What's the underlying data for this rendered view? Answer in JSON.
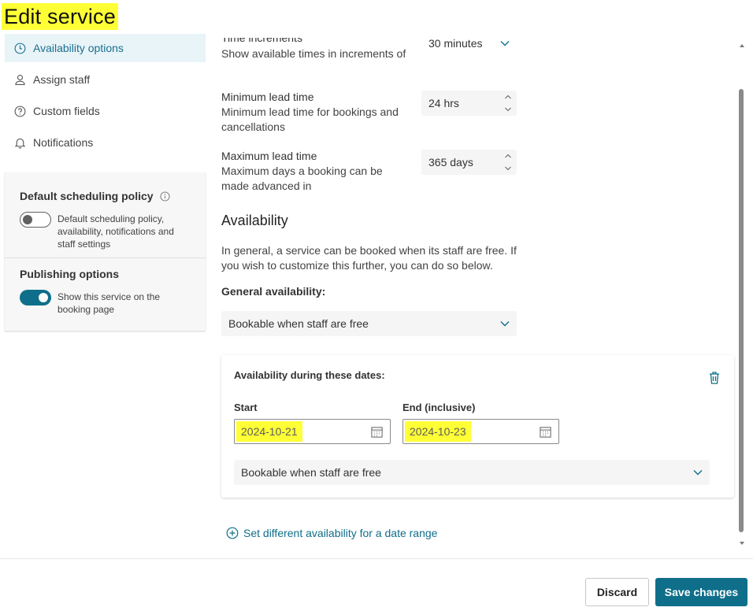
{
  "header": {
    "title": "Edit service"
  },
  "nav": {
    "items": [
      {
        "label": "Availability options",
        "icon": "clock-icon",
        "active": true
      },
      {
        "label": "Assign staff",
        "icon": "person-icon"
      },
      {
        "label": "Custom fields",
        "icon": "question-icon"
      },
      {
        "label": "Notifications",
        "icon": "bell-icon"
      }
    ]
  },
  "policy": {
    "default_heading": "Default scheduling policy",
    "default_toggle_text": "Default scheduling policy, availability, notifications and staff settings",
    "default_toggle_on": false,
    "publishing_heading": "Publishing options",
    "publishing_toggle_text": "Show this service on the booking page",
    "publishing_toggle_on": true
  },
  "fields": {
    "time_increments_label": "Time increments",
    "time_increments_desc": "Show available times in increments of",
    "time_increments_value": "30 minutes",
    "min_lead_label": "Minimum lead time",
    "min_lead_desc": "Minimum lead time for bookings and cancellations",
    "min_lead_value": "24 hrs",
    "max_lead_label": "Maximum lead time",
    "max_lead_desc": "Maximum days a booking can be made advanced in",
    "max_lead_value": "365 days"
  },
  "availability": {
    "title": "Availability",
    "description": "In general, a service can be booked when its staff are free. If you wish to customize this further, you can do so below.",
    "general_label": "General availability:",
    "general_value": "Bookable when staff are free",
    "date_card": {
      "heading": "Availability during these dates:",
      "start_label": "Start",
      "start_value": "2024-10-21",
      "end_label": "End (inclusive)",
      "end_value": "2024-10-23",
      "select_value": "Bookable when staff are free"
    },
    "add_link": "Set different availability for a date range"
  },
  "footer": {
    "discard_label": "Discard",
    "save_label": "Save changes"
  },
  "colors": {
    "accent": "#0f6f8a",
    "highlight": "#ffff36",
    "active_nav_bg": "#e8f4f8"
  }
}
